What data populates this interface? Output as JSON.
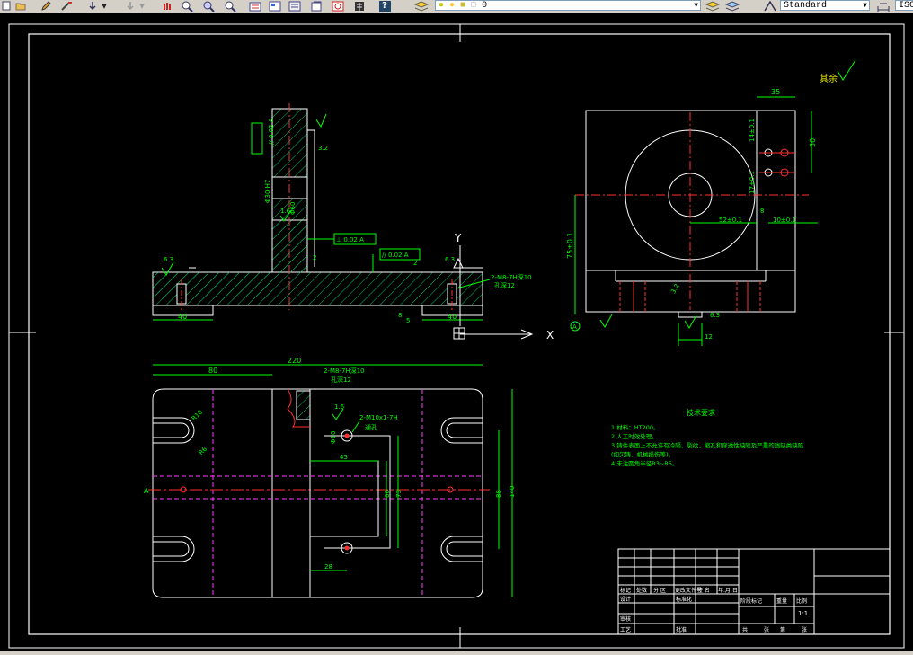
{
  "toolbar": {
    "layer_value": "0",
    "text_style": "Standard",
    "dim_style_prefix": "ISC",
    "help_label": "?"
  },
  "drawing": {
    "roughness_top_right": "其余",
    "side_view": {
      "label_y": "Y",
      "label_x": "X",
      "label_a": "A",
      "tol_parallel_1": "// 0.02 A",
      "tol_perp": "⊥ 0.02 A",
      "tol_parallel_2": "// 0.02 A",
      "dim_phi30": "Φ30 H7",
      "dim_phi60": "Φ60",
      "dim_40_left": "40",
      "dim_40_right": "40",
      "dim_2a": "2",
      "dim_2b": "2",
      "dim_8": "8",
      "dim_5": "5",
      "rough_63_left": "6.3",
      "rough_63_right": "6.3",
      "rough_16": "1.6",
      "rough_32": "3.2",
      "rough_32b": "3.2",
      "thread_note_1": "2-M8-7H深10",
      "thread_note_2": "孔深12"
    },
    "right_view": {
      "dim_35": "35",
      "dim_50": "50",
      "dim_14": "14±0.1",
      "dim_17": "17±0.1",
      "dim_52": "52±0.1",
      "dim_10": "10±0.1",
      "dim_8": "8",
      "dim_75": "75±0.1",
      "dim_12": "12",
      "rough_32": "3.2",
      "rough_63": "6.3",
      "label_a": "A"
    },
    "plan_view": {
      "dim_220": "220",
      "dim_80": "80",
      "dim_45": "45",
      "dim_60": "60",
      "dim_73": "73",
      "dim_28": "28",
      "dim_88": "88",
      "dim_140": "140",
      "dim_r10": "R10",
      "dim_r6": "R6",
      "label_a": "A",
      "thread_note_1": "2-M8-7H深10",
      "thread_note_2": "孔深12",
      "thread_note_3": "2-M10x1-7H",
      "thread_note_4": "通孔",
      "rough_16": "1.6",
      "phi10": "Φ10"
    },
    "tech_req": {
      "title": "技术要求",
      "line1": "1.材料：HT200。",
      "line2": "2.人工时效处理。",
      "line3": "3.铸件表面上不允许有冷隔、裂纹、缩孔和穿透性缺陷及严重的残缺类缺陷",
      "line4": "(如欠铸、机械损伤等)。",
      "line5": "4.未注圆角半径R3~R5。"
    },
    "title_block": {
      "h1": "标记",
      "h2": "处数",
      "h3": "分 区",
      "h4": "更改文件号",
      "h5": "签 名",
      "h6": "年.月.日",
      "design": "设计",
      "standard": "标准化",
      "stage": "阶段标记",
      "weight": "重量",
      "scale": "比例",
      "scale_val": "1:1",
      "review": "审核",
      "process": "工艺",
      "approve": "批准",
      "total": "共",
      "sheet": "张",
      "page": "第",
      "page2": "张"
    }
  }
}
